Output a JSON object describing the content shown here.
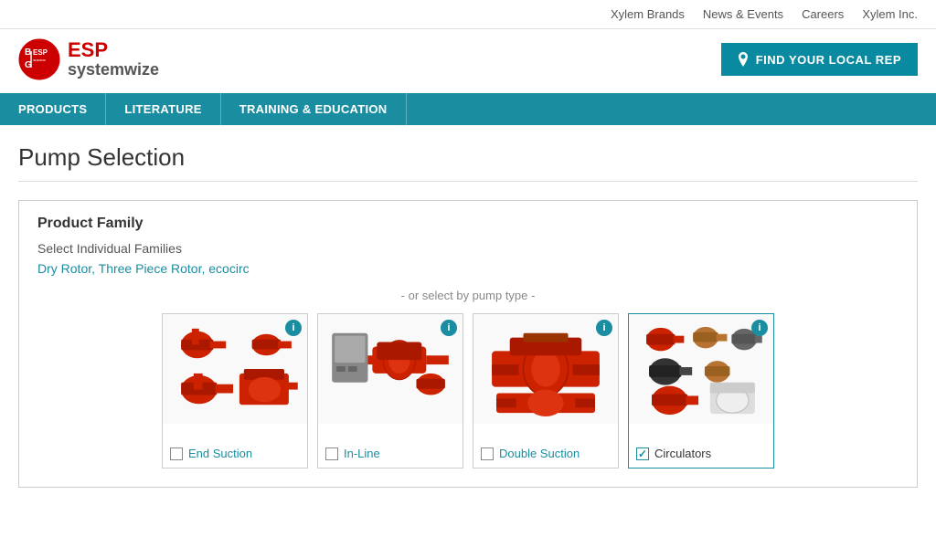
{
  "topbar": {
    "links": [
      "Xylem Brands",
      "News & Events",
      "Careers",
      "Xylem Inc."
    ]
  },
  "header": {
    "logo_esp": "ESP",
    "logo_systemwize": "systemwize",
    "find_rep_button": "FIND YOUR LOCAL REP"
  },
  "nav": {
    "items": [
      "PRODUCTS",
      "LITERATURE",
      "TRAINING & EDUCATION"
    ]
  },
  "page": {
    "title": "Pump Selection",
    "product_family": {
      "section_title": "Product Family",
      "select_label": "Select Individual Families",
      "families_link": "Dry Rotor, Three Piece Rotor, ecocirc",
      "or_select_text": "- or select by pump type -"
    },
    "pump_types": [
      {
        "id": "end-suction",
        "label": "End Suction",
        "checked": false,
        "color": "#cc2200"
      },
      {
        "id": "in-line",
        "label": "In-Line",
        "checked": false,
        "color": "#cc2200"
      },
      {
        "id": "double-suction",
        "label": "Double Suction",
        "checked": false,
        "color": "#cc2200"
      },
      {
        "id": "circulators",
        "label": "Circulators",
        "checked": true,
        "color": "#cc2200"
      }
    ]
  }
}
